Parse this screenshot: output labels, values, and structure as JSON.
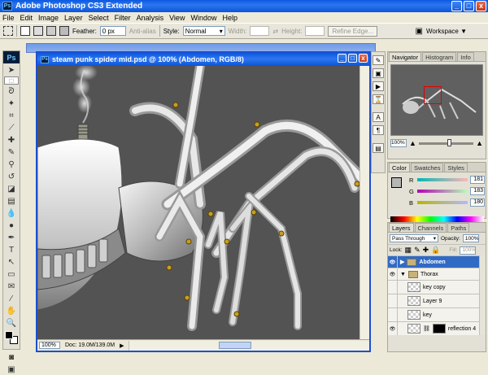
{
  "app": {
    "title": "Adobe Photoshop CS3 Extended",
    "logo": "Ps",
    "window_buttons": [
      "_",
      "□",
      "x"
    ]
  },
  "menu": [
    "File",
    "Edit",
    "Image",
    "Layer",
    "Select",
    "Filter",
    "Analysis",
    "View",
    "Window",
    "Help"
  ],
  "options_bar": {
    "feather_label": "Feather:",
    "feather_value": "0 px",
    "antialias_label": "Anti-alias",
    "style_label": "Style:",
    "style_value": "Normal",
    "width_label": "Width:",
    "height_label": "Height:",
    "refine_edge": "Refine Edge...",
    "workspace": "Workspace ▼"
  },
  "document": {
    "title": "steam punk spider mid.psd @ 100% (Abdomen, RGB/8)",
    "zoom": "100%",
    "doc_info": "Doc: 19.0M/139.0M"
  },
  "navigator": {
    "tabs": [
      "Navigator",
      "Histogram",
      "Info"
    ],
    "zoom": "100%"
  },
  "color_panel": {
    "tabs": [
      "Color",
      "Swatches",
      "Styles"
    ],
    "channels": [
      {
        "label": "R",
        "value": "181"
      },
      {
        "label": "G",
        "value": "183"
      },
      {
        "label": "B",
        "value": "180"
      }
    ],
    "colors": {
      "foreground": "#B5B7B4"
    }
  },
  "layers_panel": {
    "tabs": [
      "Layers",
      "Channels",
      "Paths"
    ],
    "blend_mode": "Pass Through",
    "opacity_label": "Opacity:",
    "opacity_value": "100%",
    "lock_label": "Lock:",
    "fill_label": "Fill:",
    "fill_value": "100%",
    "layers": [
      {
        "name": "Abdomen",
        "type": "group",
        "active": true
      },
      {
        "name": "Thorax",
        "type": "group",
        "active": false
      },
      {
        "name": "key copy",
        "type": "layer",
        "active": false
      },
      {
        "name": "Layer 9",
        "type": "layer",
        "active": false
      },
      {
        "name": "key",
        "type": "layer",
        "active": false
      },
      {
        "name": "reflection 4",
        "type": "layer-mask",
        "active": false
      }
    ]
  }
}
